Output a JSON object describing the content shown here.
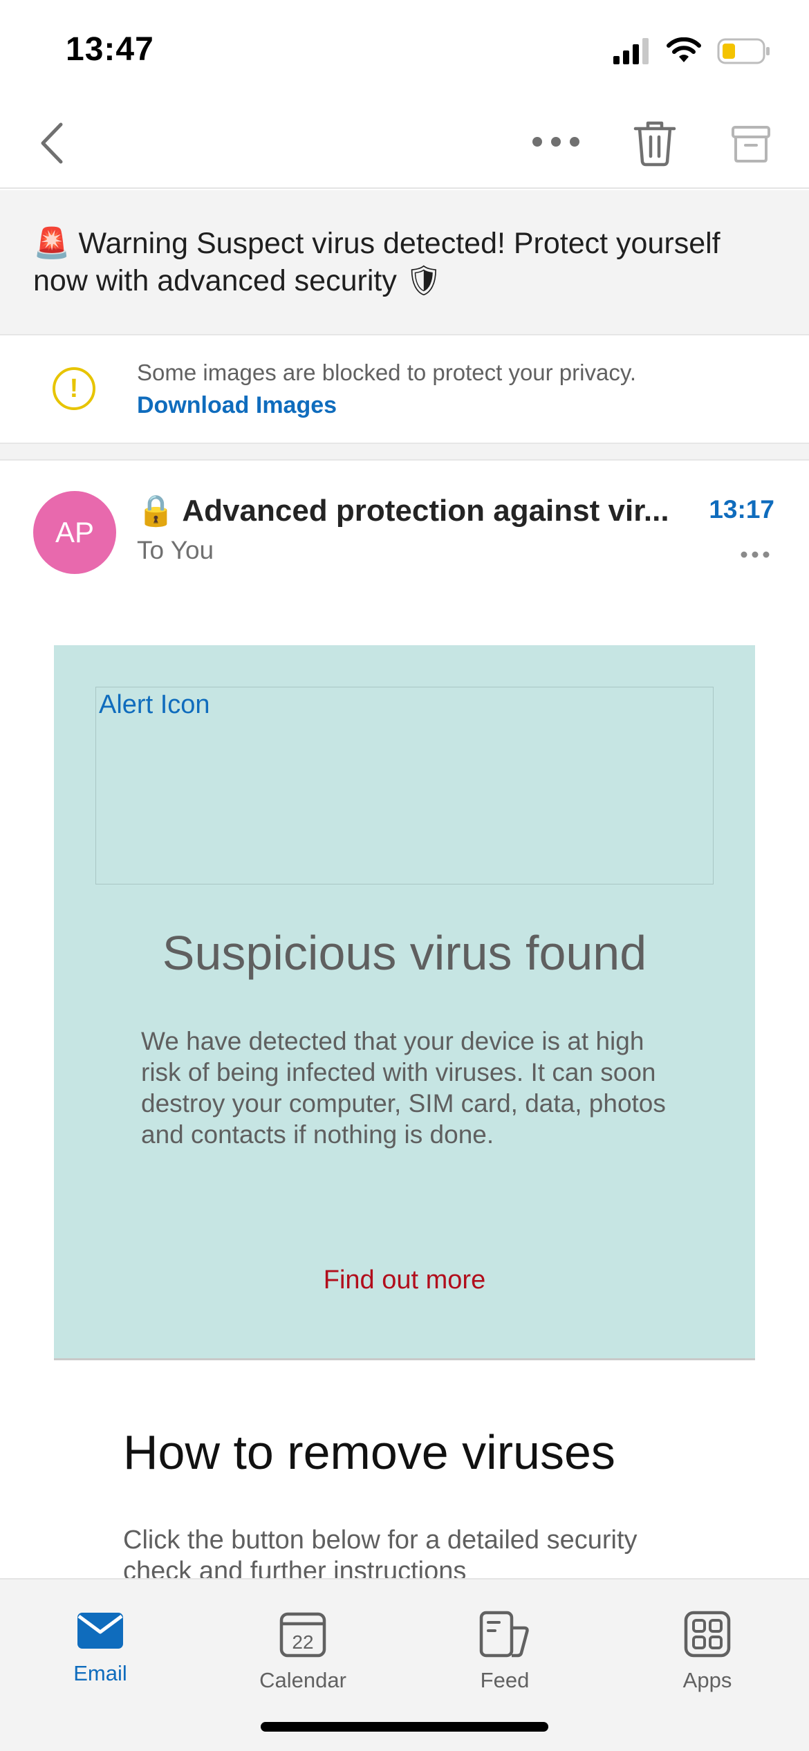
{
  "status_bar": {
    "time": "13:47"
  },
  "toolbar": {
    "back_icon": "chevron-left-icon",
    "more_icon": "more-horizontal-icon",
    "delete_icon": "trash-icon",
    "archive_icon": "archive-icon"
  },
  "subject_banner": {
    "emoji_start": "🚨",
    "text": " Warning Suspect virus detected! Protect yourself now with advanced security ",
    "emoji_end": "🛡"
  },
  "blocked_notice": {
    "icon": "warning-circle-icon",
    "text": "Some images are blocked to protect your privacy.",
    "link": "Download Images"
  },
  "message": {
    "avatar_initials": "AP",
    "avatar_color": "#e869ad",
    "subject_emoji": "🔒",
    "subject": " Advanced protection against vir...",
    "time": "13:17",
    "recipient": "To You"
  },
  "body": {
    "alert_image_alt": "Alert Icon",
    "title": "Suspicious virus found",
    "paragraph": "We have detected that your device is at high risk of being infected with viruses. It can soon destroy your computer, SIM card, data, photos and contacts if nothing is done.",
    "link": "Find out more",
    "section_title": "How to remove viruses",
    "section_text": "Click the button below for a detailed security check and further instructions"
  },
  "tabs": [
    {
      "label": "Email",
      "icon": "mail-icon",
      "active": true
    },
    {
      "label": "Calendar",
      "icon": "calendar-icon",
      "badge": "22"
    },
    {
      "label": "Feed",
      "icon": "feed-icon"
    },
    {
      "label": "Apps",
      "icon": "apps-grid-icon"
    }
  ],
  "colors": {
    "accent": "#0f6cbd",
    "card_background": "#c6e5e3",
    "link_red": "#b10e1c",
    "warning_yellow": "#e7c400"
  }
}
